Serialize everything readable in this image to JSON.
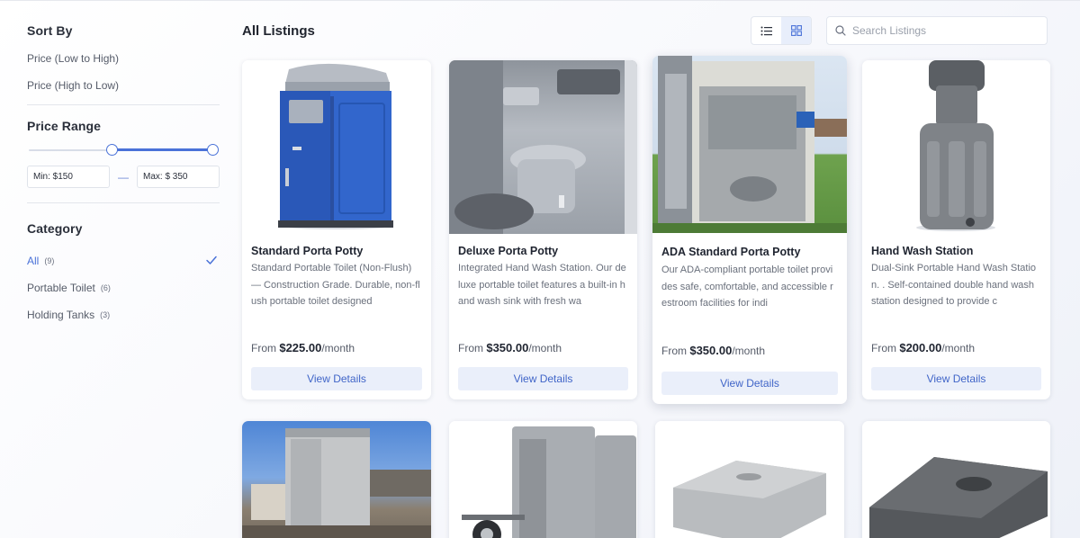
{
  "sidebar": {
    "sort_heading": "Sort By",
    "sort_options": [
      "Price (Low to High)",
      "Price (High to Low)"
    ],
    "price_heading": "Price Range",
    "min_label": "Min: $150",
    "max_label": "Max: $ 350",
    "range_sep": "—",
    "category_heading": "Category",
    "categories": [
      {
        "label": "All",
        "count": "(9)",
        "active": true
      },
      {
        "label": "Portable Toilet",
        "count": "(6)",
        "active": false
      },
      {
        "label": "Holding Tanks",
        "count": "(3)",
        "active": false
      }
    ]
  },
  "header": {
    "title": "All Listings",
    "view_modes": [
      "list",
      "grid"
    ],
    "active_view": "grid",
    "search_placeholder": "Search Listings"
  },
  "listings": [
    {
      "title": "Standard Porta Potty",
      "description": "Standard Portable Toilet (Non-Flush) — Construction Grade. Durable, non-flush portable toilet designed",
      "price_prefix": "From ",
      "price": "$225.00",
      "price_suffix": "/month",
      "button": "View Details",
      "image": "blue-porta-potty"
    },
    {
      "title": "Deluxe Porta Potty",
      "description": "Integrated Hand Wash Station. Our deluxe portable toilet features a built-in hand wash sink with fresh wa",
      "price_prefix": "From ",
      "price": "$350.00",
      "price_suffix": "/month",
      "button": "View Details",
      "image": "deluxe-interior"
    },
    {
      "title": "ADA Standard Porta Potty",
      "description": "Our ADA-compliant portable toilet provides safe, comfortable, and accessible restroom facilities for indi",
      "price_prefix": "From ",
      "price": "$350.00",
      "price_suffix": "/month",
      "button": "View Details",
      "image": "ada-unit-open"
    },
    {
      "title": "Hand Wash Station",
      "description": "Dual-Sink Portable Hand Wash Station. . Self-contained double hand wash station designed to provide c",
      "price_prefix": "From ",
      "price": "$200.00",
      "price_suffix": "/month",
      "button": "View Details",
      "image": "hand-wash-station"
    }
  ],
  "second_row_images": [
    "porta-potty-yard",
    "trailer-units",
    "flat-holding-tank",
    "dark-holding-tank"
  ],
  "colors": {
    "accent": "#4a72d8",
    "button_bg": "#eaeffa",
    "button_text": "#4065c8",
    "potty_blue": "#2f63c8"
  }
}
